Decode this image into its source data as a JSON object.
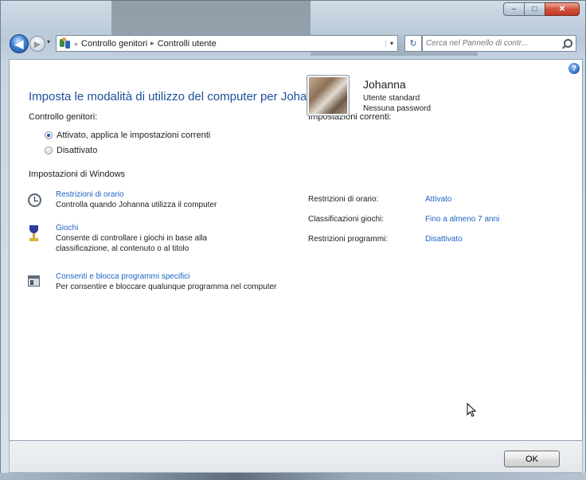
{
  "window": {
    "app_title": "",
    "buttons": {
      "minimize": "–",
      "maximize": "□",
      "close": "✕"
    }
  },
  "nav": {
    "back_icon": "arrow-left-icon",
    "forward_icon": "arrow-right-icon",
    "history_icon": "▾",
    "breadcrumb_prefix": "«",
    "breadcrumb": [
      "Controllo genitori",
      "Controlli utente"
    ],
    "breadcrumb_sep": "▸",
    "address_dropdown": "▾",
    "refresh": "↻",
    "search_placeholder": "Cerca nel Pannello di contr..."
  },
  "page": {
    "help": "?",
    "title": "Imposta le modalità di utilizzo del computer per Johanna",
    "parental_label": "Controllo genitori:",
    "radio_on": "Attivato, applica le impostazioni correnti",
    "radio_off": "Disattivato",
    "windows_settings_label": "Impostazioni di Windows",
    "tasks": [
      {
        "link": "Restrizioni di orario",
        "desc": "Controlla quando Johanna utilizza il computer"
      },
      {
        "link": "Giochi",
        "desc": "Consente di controllare i giochi in base alla classificazione, al contenuto o al titolo"
      },
      {
        "link": "Consenti e blocca programmi specifici",
        "desc": "Per consentire e bloccare qualunque programma nel computer"
      }
    ],
    "current_settings_label": "Impostazioni correnti:",
    "user": {
      "name": "Johanna",
      "type": "Utente standard",
      "password": "Nessuna password"
    },
    "stats": [
      {
        "label": "Restrizioni di orario:",
        "value": "Attivato"
      },
      {
        "label": "Classificazioni giochi:",
        "value": "Fino a almeno 7 anni"
      },
      {
        "label": "Restrizioni programmi:",
        "value": "Disattivato"
      }
    ]
  },
  "footer": {
    "ok": "OK"
  },
  "colors": {
    "link": "#1f63c6",
    "title": "#1d4f9a"
  }
}
